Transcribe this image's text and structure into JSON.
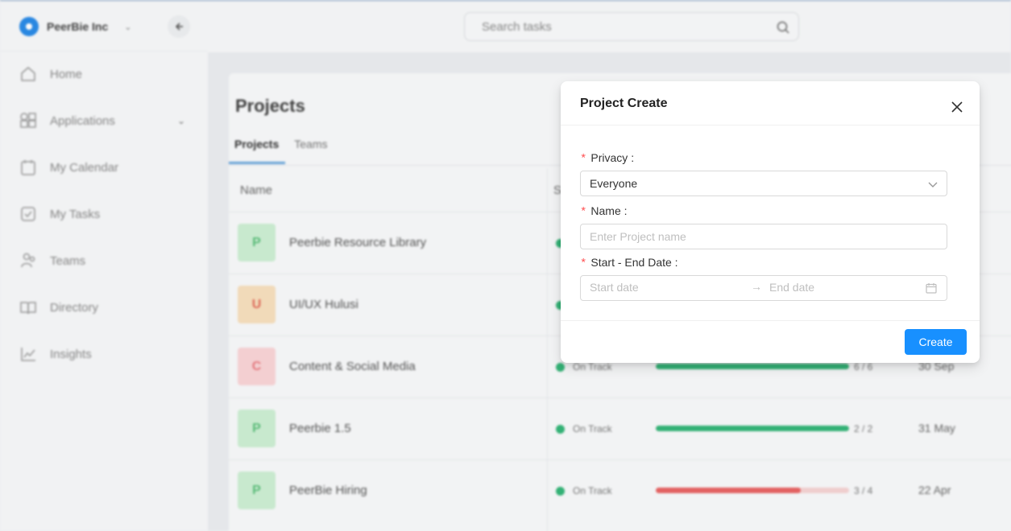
{
  "sidebar": {
    "org_name": "PeerBie Inc",
    "items": [
      {
        "label": "Home",
        "icon": "home-icon"
      },
      {
        "label": "Applications",
        "icon": "apps-icon",
        "has_chevron": true
      },
      {
        "label": "My Calendar",
        "icon": "calendar-icon"
      },
      {
        "label": "My Tasks",
        "icon": "tasks-icon"
      },
      {
        "label": "Teams",
        "icon": "teams-icon"
      },
      {
        "label": "Directory",
        "icon": "directory-icon"
      },
      {
        "label": "Insights",
        "icon": "insights-icon"
      }
    ]
  },
  "header": {
    "search_placeholder": "Search tasks"
  },
  "main": {
    "title": "Projects",
    "tabs": [
      {
        "label": "Projects",
        "active": true
      },
      {
        "label": "Teams",
        "active": false
      }
    ],
    "columns": [
      "Name",
      "S"
    ],
    "rows": [
      {
        "initial": "P",
        "name": "Peerbie Resource Library",
        "color_bg": "#cdeed3",
        "color_fg": "#5bbf7a",
        "status": "",
        "progress": "",
        "date": ""
      },
      {
        "initial": "U",
        "name": "UI/UX Hulusi",
        "color_bg": "#f6dfbd",
        "color_fg": "#e26b5a",
        "status": "",
        "progress": "",
        "date": ""
      },
      {
        "initial": "C",
        "name": "Content & Social Media",
        "color_bg": "#f8d4d6",
        "color_fg": "#e87a80",
        "status": "On Track",
        "progress": "6 / 6",
        "fraction": 1.0,
        "bar_color": "#35b578",
        "date": "30 Sep"
      },
      {
        "initial": "P",
        "name": "Peerbie 1.5",
        "color_bg": "#cdeed3",
        "color_fg": "#5bbf7a",
        "status": "On Track",
        "progress": "2 / 2",
        "fraction": 1.0,
        "bar_color": "#35b578",
        "date": "31 May"
      },
      {
        "initial": "P",
        "name": "PeerBie Hiring",
        "color_bg": "#cdeed3",
        "color_fg": "#5bbf7a",
        "status": "On Track",
        "progress": "3 / 4",
        "fraction": 0.75,
        "bar_color": "#e86464",
        "date": "22 Apr"
      }
    ]
  },
  "modal": {
    "title": "Project Create",
    "privacy_label": "Privacy",
    "privacy_value": "Everyone",
    "name_label": "Name",
    "name_placeholder": "Enter Project name",
    "date_label": "Start - End Date",
    "start_placeholder": "Start date",
    "end_placeholder": "End date",
    "create_label": "Create",
    "accent_color": "#1890ff",
    "required_color": "#ff4d4f"
  }
}
